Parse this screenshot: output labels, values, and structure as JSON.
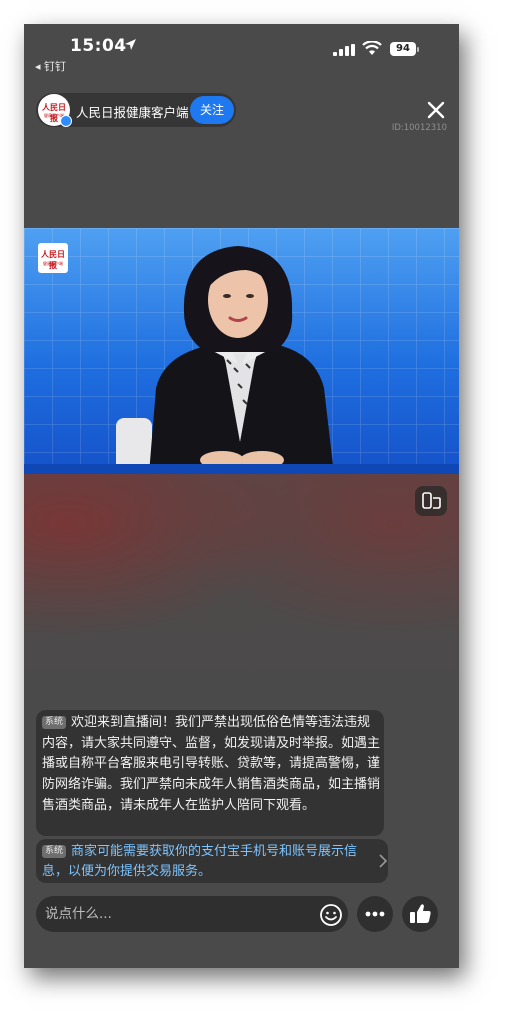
{
  "status_bar": {
    "time": "15:04",
    "back_app": "◂ 钉钉",
    "battery": "94"
  },
  "anchor": {
    "name": "人民日报健康客户端",
    "follow_label": "关注",
    "logo_text": "人民日报",
    "logo_subtext": "健康客户端"
  },
  "room": {
    "id_text": "ID:10012310"
  },
  "video": {
    "logo_text": "人民日报",
    "logo_subtext": "健康客户端"
  },
  "messages": [
    {
      "tag": "系统",
      "text": "欢迎来到直播间！我们严禁出现低俗色情等违法违规内容，请大家共同遵守、监督，如发现请及时举报。如遇主播或自称平台客服来电引导转账、贷款等，请提高警惕，谨防网络诈骗。我们严禁向未成年人销售酒类商品，如主播销售酒类商品，请未成年人在监护人陪同下观看。"
    },
    {
      "tag": "系统",
      "text": "商家可能需要获取你的支付宝手机号和账号展示信息，以便为你提供交易服务。"
    }
  ],
  "bottom_bar": {
    "input_placeholder": "说点什么..."
  },
  "colors": {
    "accent": "#1e78f0",
    "link_text": "#7ec4ff",
    "background": "#4a4a4a"
  },
  "icons": [
    "location-arrow-icon",
    "signal-icon",
    "wifi-icon",
    "close-icon",
    "rotate-screen-icon",
    "chevron-right-icon",
    "emoji-icon",
    "more-icon",
    "thumbs-up-icon",
    "verified-icon"
  ]
}
